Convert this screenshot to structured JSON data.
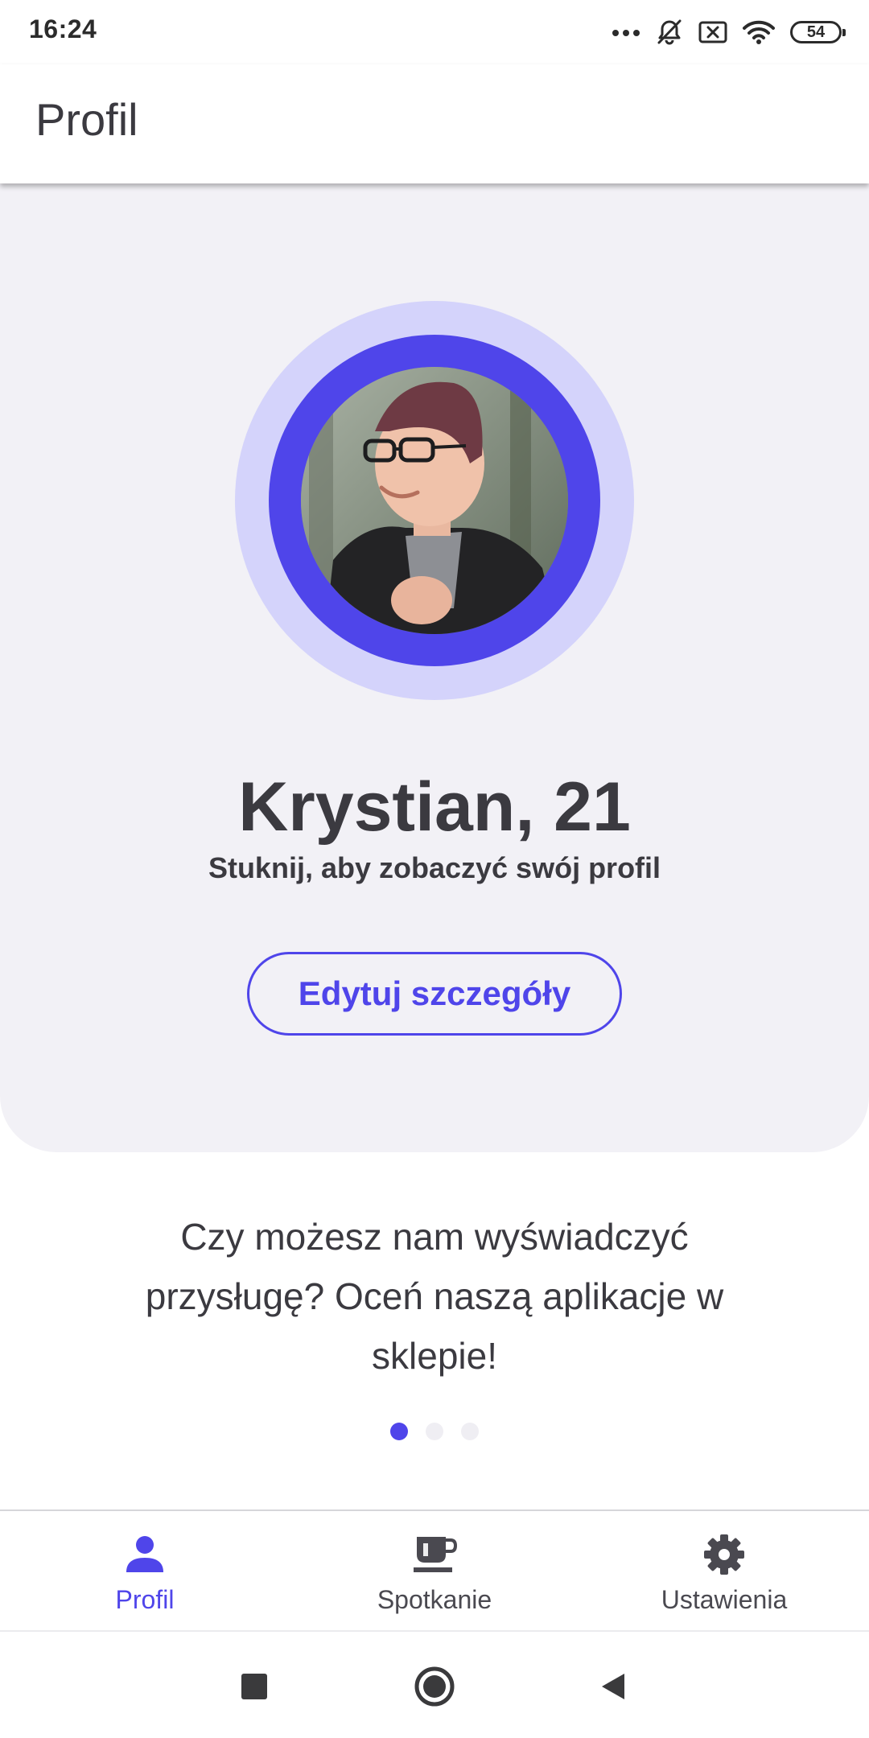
{
  "status_bar": {
    "time": "16:24",
    "battery": "54",
    "icons": [
      "more-dots-icon",
      "notifications-off-icon",
      "sim-off-icon",
      "wifi-icon",
      "battery-icon"
    ]
  },
  "app_bar": {
    "title": "Profil"
  },
  "profile": {
    "name_age": "Krystian, 21",
    "hint": "Stuknij, aby zobaczyć swój profil",
    "edit_label": "Edytuj szczegóły"
  },
  "rating": {
    "text": "Czy możesz nam wyświadczyć przysługę? Oceń naszą aplikacje w sklepie!",
    "pages": 3,
    "active_page": 1
  },
  "bottom_nav": {
    "items": [
      {
        "label": "Profil",
        "icon": "person-icon",
        "active": true
      },
      {
        "label": "Spotkanie",
        "icon": "coffee-icon",
        "active": false
      },
      {
        "label": "Ustawienia",
        "icon": "gear-icon",
        "active": false
      }
    ]
  },
  "system_nav": {
    "buttons": [
      "recents-square-icon",
      "home-circle-icon",
      "back-triangle-icon"
    ]
  },
  "colors": {
    "accent": "#4f45ea",
    "accent_light": "#d4d3fb",
    "card_background": "#f2f1f6",
    "text": "#3b3a40"
  }
}
